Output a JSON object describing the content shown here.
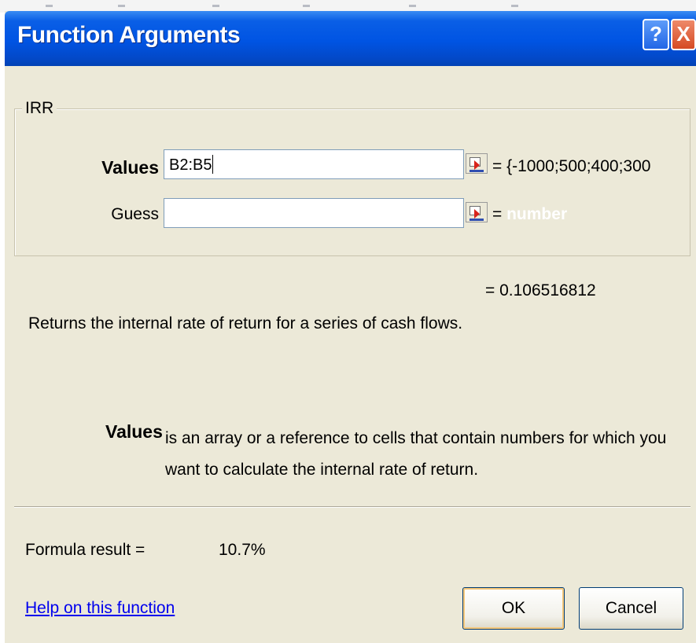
{
  "dialog": {
    "title": "Function Arguments",
    "help_glyph": "?",
    "close_glyph": "X"
  },
  "function_group": {
    "label": "IRR",
    "args": [
      {
        "name": "Values",
        "value": "B2:B5",
        "evaluated": "= {-1000;500;400;300"
      },
      {
        "name": "Guess",
        "value": "",
        "evaluated_prefix": "=",
        "evaluated_type": "number"
      }
    ]
  },
  "result_preview": "= 0.106516812",
  "function_description": "Returns the internal rate of return for a series of cash flows.",
  "argument_help": {
    "name": "Values",
    "text": "is an array or a reference to cells that contain numbers for which you want to calculate the internal rate of return."
  },
  "formula_result": {
    "label": "Formula result =",
    "value": "10.7%"
  },
  "help_link": "Help on this function",
  "buttons": {
    "ok": "OK",
    "cancel": "Cancel"
  },
  "colors": {
    "title_bar": "#0054e3",
    "dialog_bg": "#ece9d8",
    "link": "#0000ee"
  },
  "icons": [
    "help-icon",
    "close-icon",
    "collapse-dialog-icon"
  ]
}
